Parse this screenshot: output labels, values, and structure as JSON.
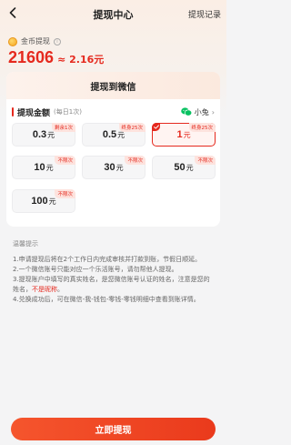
{
  "nav": {
    "title": "提现中心",
    "record": "提现记录"
  },
  "coin": {
    "label": "金币提现",
    "info_glyph": "i",
    "amount": "21606",
    "approx": "≈ 2.16元"
  },
  "tab": {
    "title": "提现到微信"
  },
  "amount_section": {
    "title": "提现金额",
    "subtitle": "(每日1次)",
    "account_name": "小兔",
    "chevron": "›"
  },
  "options": [
    {
      "value": "0.3",
      "unit": "元",
      "tag": "剩余1次",
      "selected": false
    },
    {
      "value": "0.5",
      "unit": "元",
      "tag": "终身25次",
      "selected": false
    },
    {
      "value": "1",
      "unit": "元",
      "tag": "终身25次",
      "selected": true
    },
    {
      "value": "10",
      "unit": "元",
      "tag": "不限次",
      "selected": false
    },
    {
      "value": "30",
      "unit": "元",
      "tag": "不限次",
      "selected": false
    },
    {
      "value": "50",
      "unit": "元",
      "tag": "不限次",
      "selected": false
    },
    {
      "value": "100",
      "unit": "元",
      "tag": "不限次",
      "selected": false
    }
  ],
  "tips": {
    "title": "温馨提示",
    "items": [
      "1.申请提现后将在2个工作日内完成审核并打款到账，节假日顺延。",
      "2.一个微信账号只能对应一个乐活账号，请勿帮他人提现。",
      "3.提现账户中填写的真实姓名，是您微信账号认证的姓名，注意是您的姓名，",
      "不是昵称",
      "。",
      "4.兑换成功后，可在微信-我-钱包-零钱-零钱明细中查看到账详情。"
    ]
  },
  "submit": {
    "label": "立即提现"
  },
  "colors": {
    "accent": "#e5291e",
    "wechat": "#07c160"
  }
}
